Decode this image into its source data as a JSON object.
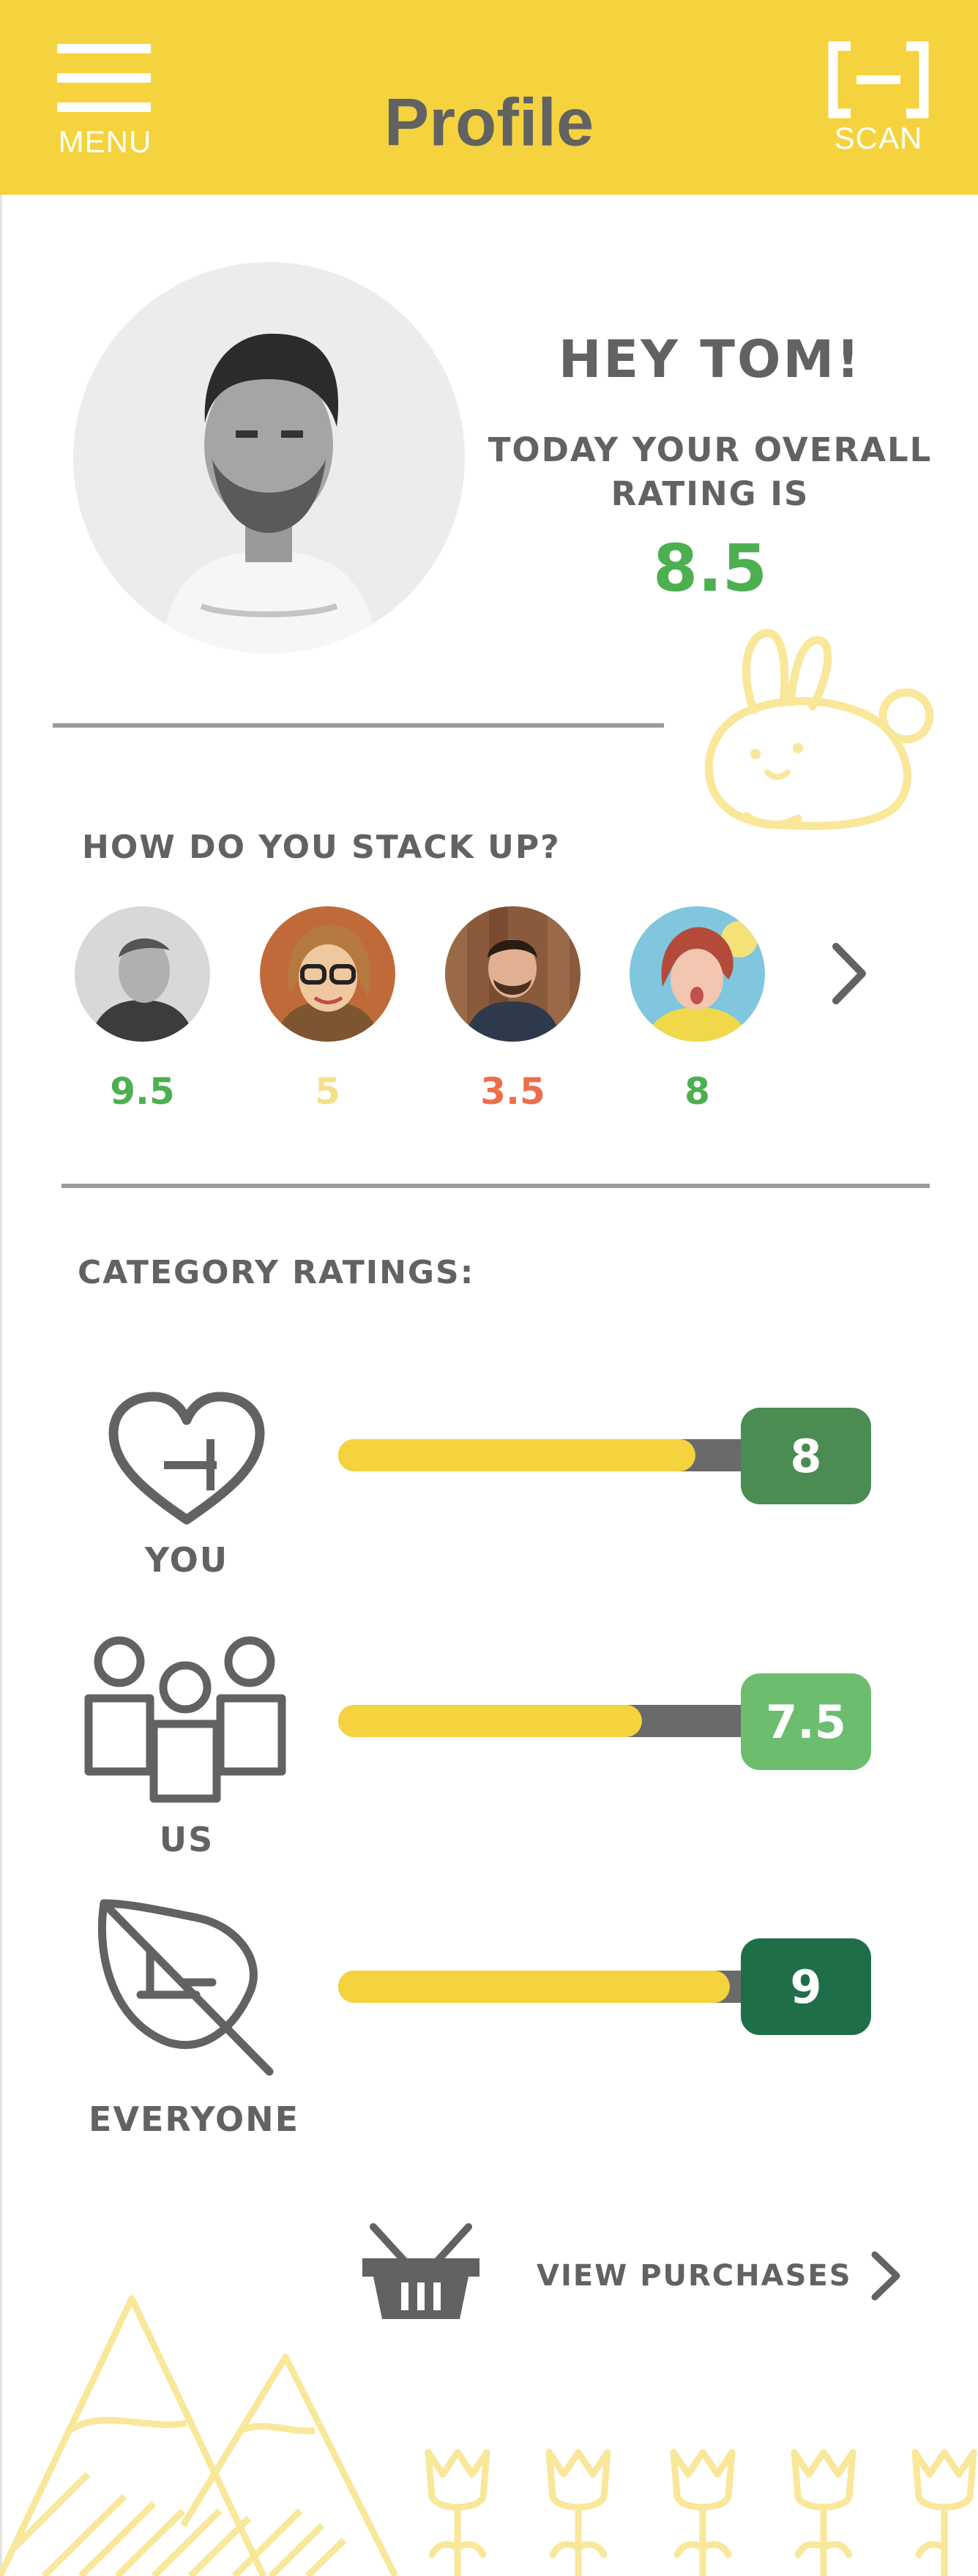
{
  "header": {
    "title": "Profile",
    "menu_label": "MENU",
    "scan_label": "SCAN",
    "menu_icon": "hamburger-icon",
    "scan_icon": "scan-bracket-icon"
  },
  "profile": {
    "greeting": "HEY TOM!",
    "rating_intro": "TODAY YOUR OVERALL RATING IS",
    "overall_rating": "8.5"
  },
  "stack": {
    "title": "HOW DO YOU STACK UP?",
    "friends": [
      {
        "score": "9.5",
        "score_color": "#4caf50"
      },
      {
        "score": "5",
        "score_color": "#f5e08a"
      },
      {
        "score": "3.5",
        "score_color": "#ee6e4a"
      },
      {
        "score": "8",
        "score_color": "#4caf50"
      }
    ],
    "next_icon": "chevron-right-icon"
  },
  "categories": {
    "title": "CATEGORY RATINGS:",
    "items": [
      {
        "label": "YOU",
        "value": "8",
        "fill_fraction": 0.8,
        "badge_color": "#4a8c52",
        "icon": "heart-plus-icon"
      },
      {
        "label": "US",
        "value": "7.5",
        "fill_fraction": 0.75,
        "badge_color": "#6cbd6e",
        "icon": "group-icon"
      },
      {
        "label": "EVERYONE",
        "value": "9",
        "fill_fraction": 0.9,
        "badge_color": "#1e6e47",
        "icon": "leaf-icon"
      }
    ]
  },
  "purchases": {
    "label": "VIEW PURCHASES",
    "icon": "basket-icon"
  },
  "colors": {
    "brand_yellow": "#f5d33e",
    "text_gray": "#626262",
    "good_green": "#4caf50",
    "decor_yellow": "#f9e79a"
  }
}
